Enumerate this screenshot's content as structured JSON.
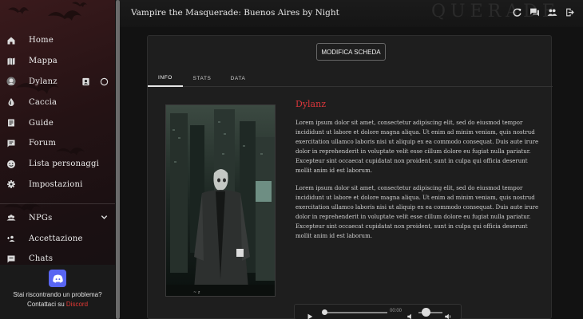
{
  "app": {
    "title": "Vampire the Masquerade: Buenos Aires by Night",
    "watermark": "QUERADE"
  },
  "topbar_icons": [
    "refresh-icon",
    "chat-icon",
    "group-icon",
    "logout-icon"
  ],
  "sidebar": {
    "items": [
      {
        "label": "Home",
        "icon": "home-icon"
      },
      {
        "label": "Mappa",
        "icon": "map-icon"
      },
      {
        "label": "Dylanz",
        "icon": "avatar-icon"
      },
      {
        "label": "Caccia",
        "icon": "blood-drop-icon"
      },
      {
        "label": "Guide",
        "icon": "guide-icon"
      },
      {
        "label": "Forum",
        "icon": "forum-icon"
      },
      {
        "label": "Lista personaggi",
        "icon": "face-icon"
      },
      {
        "label": "Impostazioni",
        "icon": "gear-icon"
      },
      {
        "label": "NPGs",
        "icon": "people-icon"
      },
      {
        "label": "Accettazione",
        "icon": "add-group-icon"
      },
      {
        "label": "Chats",
        "icon": "chats-icon"
      }
    ],
    "help": {
      "text": "Stai riscontrando un problema? Contattaci su",
      "link": "Discord"
    }
  },
  "card": {
    "edit_label": "MODIFICA SCHEDA",
    "tabs": [
      "INFO",
      "STATS",
      "DATA"
    ],
    "active_tab": "INFO",
    "character_name": "Dylanz",
    "paragraphs": [
      "Lorem ipsum dolor sit amet, consectetur adipiscing elit, sed do eiusmod tempor incididunt ut labore et dolore magna aliqua. Ut enim ad minim veniam, quis nostrud exercitation ullamco laboris nisi ut aliquip ex ea commodo consequat. Duis aute irure dolor in reprehenderit in voluptate velit esse cillum dolore eu fugiat nulla pariatur. Excepteur sint occaecat cupidatat non proident, sunt in culpa qui officia deserunt mollit anim id est laborum.",
      "Lorem ipsum dolor sit amet, consectetur adipiscing elit, sed do eiusmod tempor incididunt ut labore et dolore magna aliqua. Ut enim ad minim veniam, quis nostrud exercitation ullamco laboris nisi ut aliquip ex ea commodo consequat. Duis aute irure dolor in reprehenderit in voluptate velit esse cillum dolore eu fugiat nulla pariatur. Excepteur sint occaecat cupidatat non proident, sunt in culpa qui officia deserunt mollit anim id est laborum."
    ],
    "audio": {
      "time": "00:00",
      "progress": 0,
      "volume": 0.3
    }
  },
  "colors": {
    "accent": "#d9363b",
    "discord": "#5865F2",
    "link": "#e53935"
  }
}
